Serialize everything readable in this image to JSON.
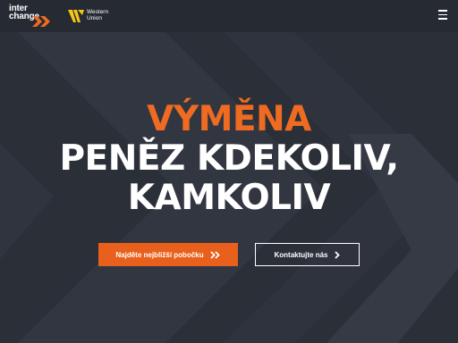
{
  "header": {
    "logo_interchange": {
      "line1": "inter",
      "line2": "change"
    },
    "logo_western_union": {
      "line1": "Western",
      "line2": "Union"
    },
    "menu_icon": "hamburger-icon"
  },
  "hero": {
    "line1": "VÝMĚNA",
    "line2": "PENĚZ KDEKOLIV,",
    "line3": "KAMKOLIV"
  },
  "buttons": {
    "primary_label": "Najděte nejbližší pobočku",
    "secondary_label": "Kontaktujte nás"
  },
  "colors": {
    "accent": "#ee6b21",
    "button_primary": "#e8601c",
    "background": "#2b2f38",
    "wu_yellow": "#f5c518"
  }
}
